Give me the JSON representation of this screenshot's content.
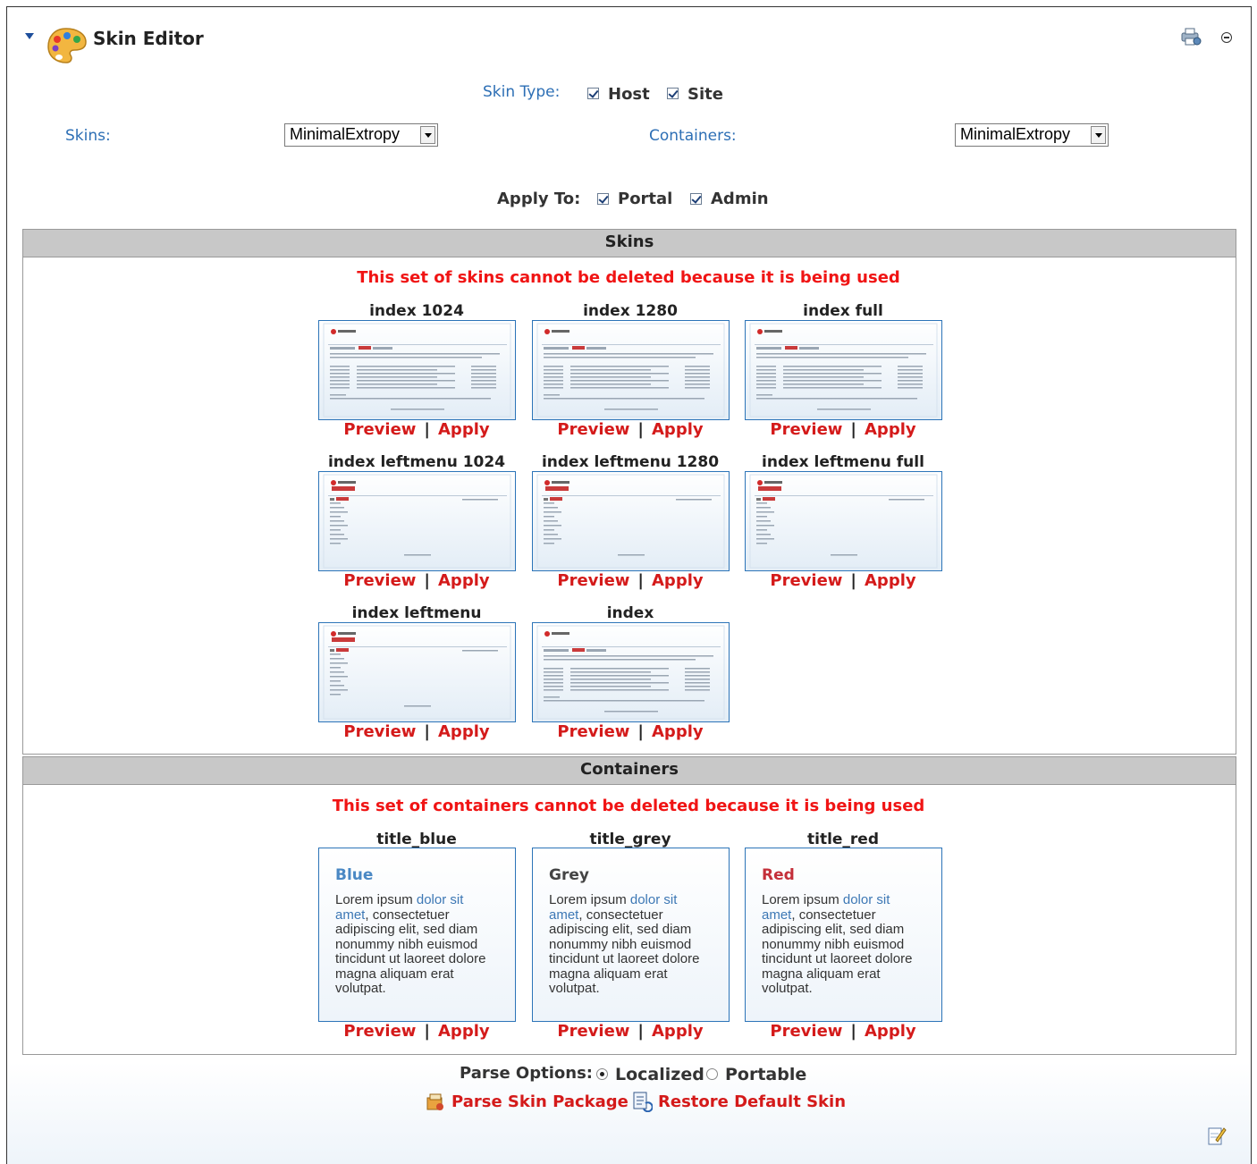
{
  "header": {
    "title": "Skin Editor"
  },
  "skin_type": {
    "label": "Skin Type:",
    "host": "Host",
    "site": "Site"
  },
  "skins_select": {
    "label": "Skins:",
    "value": "MinimalExtropy"
  },
  "containers_select": {
    "label": "Containers:",
    "value": "MinimalExtropy"
  },
  "apply_to": {
    "label": "Apply To:",
    "portal": "Portal",
    "admin": "Admin"
  },
  "skins_section": {
    "header": "Skins",
    "warning": "This set of skins cannot be deleted because it is being used",
    "items": [
      {
        "name": "index 1024"
      },
      {
        "name": "index 1280"
      },
      {
        "name": "index full"
      },
      {
        "name": "index leftmenu 1024"
      },
      {
        "name": "index leftmenu 1280"
      },
      {
        "name": "index leftmenu full"
      },
      {
        "name": "index leftmenu"
      },
      {
        "name": "index"
      }
    ]
  },
  "containers_section": {
    "header": "Containers",
    "warning": "This set of containers cannot be deleted because it is being used",
    "items": [
      {
        "name": "title_blue",
        "heading": "Blue",
        "color": "#4a88c4"
      },
      {
        "name": "title_grey",
        "heading": "Grey",
        "color": "#444444"
      },
      {
        "name": "title_red",
        "heading": "Red",
        "color": "#c4303a"
      }
    ],
    "sample_text_start": "Lorem ipsum ",
    "sample_text_link": "dolor sit amet",
    "sample_text_end": ", consectetuer adipiscing elit, sed diam nonummy nibh euismod tincidunt ut laoreet dolore magna aliquam erat volutpat."
  },
  "links": {
    "preview": "Preview",
    "separator": "|",
    "apply": "Apply"
  },
  "parse_options": {
    "label": "Parse Options:",
    "localized": "Localized",
    "portable": "Portable",
    "selected": "Localized"
  },
  "actions": {
    "parse": "Parse Skin Package",
    "restore": "Restore Default Skin"
  },
  "icons": {
    "collapse": "collapse-arrow-icon",
    "palette": "palette-icon",
    "print": "print-icon",
    "minimize": "minimize-icon",
    "parse": "package-icon",
    "restore": "restore-icon",
    "edit": "edit-icon"
  },
  "colors": {
    "link_red": "#d41a1a",
    "warning_red": "#f01414",
    "label_blue": "#2d6fb5",
    "header_grey": "#c8c8c8"
  }
}
